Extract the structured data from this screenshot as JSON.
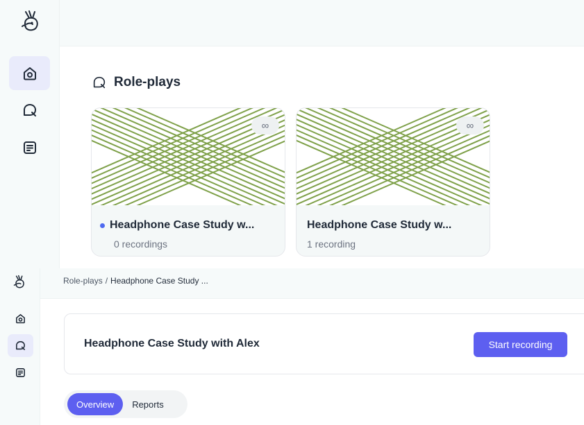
{
  "top": {
    "sidebar": {
      "logo_icon": "bird-logo-icon",
      "items": [
        {
          "icon": "home-icon",
          "active": true
        },
        {
          "icon": "chat-bubble-icon",
          "active": false
        },
        {
          "icon": "document-icon",
          "active": false
        }
      ]
    },
    "section": {
      "icon": "chat-bubble-icon",
      "title": "Role-plays"
    },
    "cards": [
      {
        "title": "Headphone Case Study w...",
        "subtitle": "0 recordings",
        "badge": "∞",
        "unread": true
      },
      {
        "title": "Headphone Case Study w...",
        "subtitle": "1 recording",
        "badge": "∞",
        "unread": false
      }
    ],
    "thumb_color": "#7fa14a"
  },
  "bottom": {
    "breadcrumb": {
      "root": "Role-plays",
      "separator": "/",
      "current": "Headphone Case Study ..."
    },
    "roleplay": {
      "title": "Headphone Case Study with Alex",
      "start_button": "Start recording"
    },
    "tabs": [
      {
        "label": "Overview",
        "active": true
      },
      {
        "label": "Reports",
        "active": false
      }
    ]
  },
  "colors": {
    "accent": "#5d5ff0",
    "active_nav_bg": "#e9ebfb",
    "sidebar_bg": "#f6fafa",
    "unread_dot": "#4f6af0"
  }
}
